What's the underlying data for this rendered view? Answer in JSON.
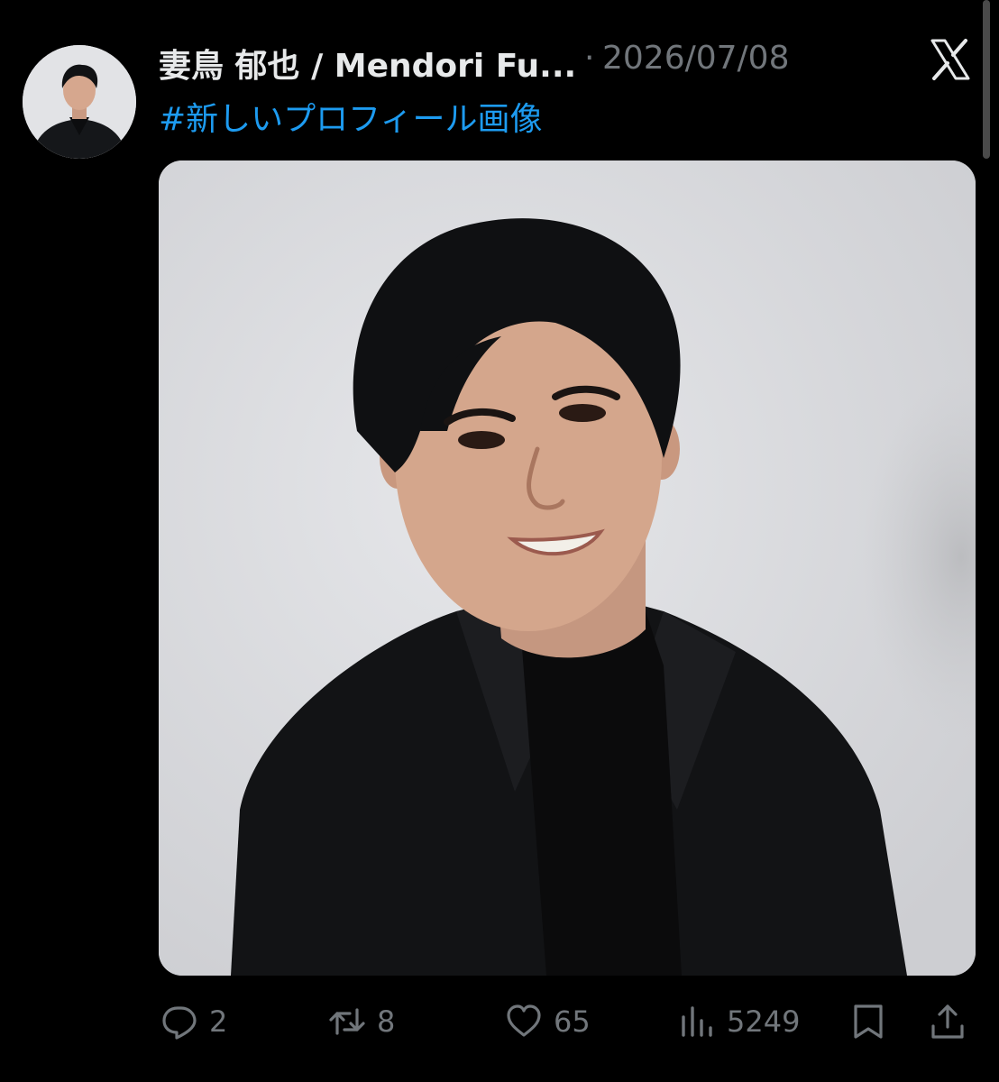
{
  "tweet": {
    "author_name": "妻鳥 郁也 / Mendori Fu...",
    "separator": "·",
    "date": "2026/07/08",
    "hashtag": "#新しいプロフィール画像"
  },
  "actions": {
    "reply_count": "2",
    "retweet_count": "8",
    "like_count": "65",
    "views_count": "5249"
  },
  "colors": {
    "background": "#000000",
    "text_primary": "#e7e9ea",
    "text_secondary": "#71767b",
    "link": "#1d9bf0"
  },
  "icons": [
    "x-logo-icon",
    "reply-icon",
    "retweet-icon",
    "like-icon",
    "views-icon",
    "bookmark-icon",
    "share-icon"
  ]
}
